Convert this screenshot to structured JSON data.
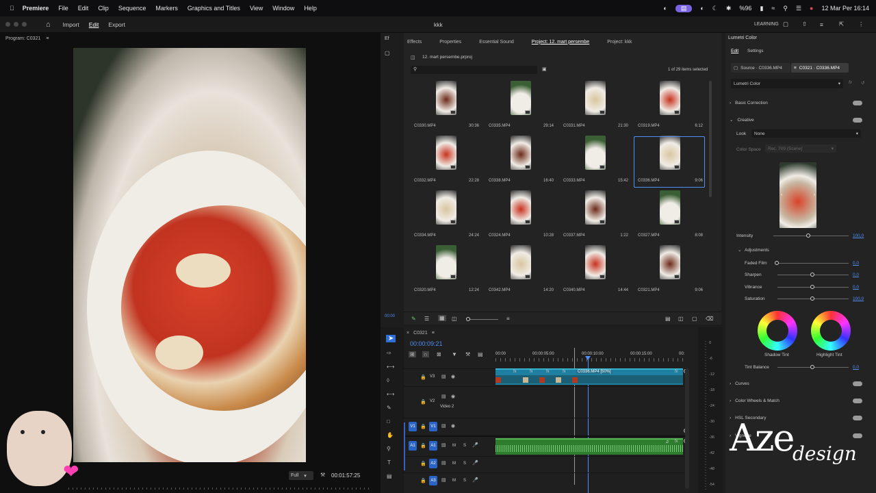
{
  "menubar": {
    "app": "Premiere",
    "items": [
      "File",
      "Edit",
      "Clip",
      "Sequence",
      "Markers",
      "Graphics and Titles",
      "View",
      "Window",
      "Help"
    ],
    "battery": "%96",
    "datetime": "12 Mar Per  16:14"
  },
  "appbar": {
    "tabs": [
      "Import",
      "Edit",
      "Export"
    ],
    "project_title": "kkk",
    "workspace": "LEARNING"
  },
  "program": {
    "title": "Program: C0321",
    "fit": "Full",
    "timecode": "00:01:57:25"
  },
  "project_panel": {
    "tabs": [
      "Effects",
      "Properties",
      "Essential Sound",
      "Project: 12. mart persembe",
      "Project: kkk"
    ],
    "side_label": "Ef",
    "path": "12. mart persembe.prproj",
    "count": "1 of 29 items selected",
    "clips": [
      {
        "name": "C0330.MP4",
        "dur": "30:36"
      },
      {
        "name": "C0335.MP4",
        "dur": "29:14"
      },
      {
        "name": "C0331.MP4",
        "dur": "21:30"
      },
      {
        "name": "C0319.MP4",
        "dur": "6:12"
      },
      {
        "name": "C0332.MP4",
        "dur": "22:28"
      },
      {
        "name": "C0338.MP4",
        "dur": "16:40"
      },
      {
        "name": "C0333.MP4",
        "dur": "15:42"
      },
      {
        "name": "C0336.MP4",
        "dur": "9:06"
      },
      {
        "name": "C0334.MP4",
        "dur": "24:24"
      },
      {
        "name": "C0324.MP4",
        "dur": "10:28"
      },
      {
        "name": "C0337.MP4",
        "dur": "1:22"
      },
      {
        "name": "C0327.MP4",
        "dur": "8:08"
      },
      {
        "name": "C0320.MP4",
        "dur": "12:24"
      },
      {
        "name": "C0342.MP4",
        "dur": "14:20"
      },
      {
        "name": "C0340.MP4",
        "dur": "14:44"
      },
      {
        "name": "C0321.MP4",
        "dur": "9:06"
      }
    ]
  },
  "timeline": {
    "sequence": "C0321",
    "timecode": "00:00:09:21",
    "ruler": [
      "00:00",
      "00:00:05:00",
      "00:00:10:00",
      "00:00:15:00",
      "00:"
    ],
    "clip_label": "C0336.MP4 [50%]",
    "tracks": {
      "v3": "V3",
      "v2": "V2",
      "v2_name": "Video 2",
      "v1": "V1",
      "a1": "A1",
      "a2": "A2",
      "a3": "A3",
      "m": "M",
      "s": "S"
    },
    "meter_ticks": [
      "0",
      "-6",
      "-12",
      "-18",
      "-24",
      "-30",
      "-36",
      "-42",
      "-48",
      "-54"
    ],
    "side_timecode": "00:00"
  },
  "lumetri": {
    "title": "Lumetri Color",
    "tabs": [
      "Edit",
      "Settings"
    ],
    "source": "Source · C0336.MP4",
    "target": "C0321 · C0336.MP4",
    "effect": "Lumetri Color",
    "sections": {
      "basic": "Basic Correction",
      "creative": "Creative",
      "curves": "Curves",
      "wheels": "Color Wheels & Match",
      "secondary": "HSL Secondary",
      "vignette": "Vignette"
    },
    "look_label": "Look",
    "look_value": "None",
    "colorspace_label": "Color Space",
    "colorspace_value": "Rec. 709 (Scene)",
    "intensity_label": "Intensity",
    "intensity_value": "100,0",
    "adjustments": "Adjustments",
    "faded_label": "Faded Film",
    "faded_value": "0,0",
    "sharpen_label": "Sharpen",
    "sharpen_value": "0,0",
    "vibrance_label": "Vibrance",
    "vibrance_value": "0,0",
    "saturation_label": "Saturation",
    "saturation_value": "100,0",
    "shadow_tint": "Shadow Tint",
    "highlight_tint": "Highlight Tint",
    "tint_label": "Tint Balance",
    "tint_value": "0,0"
  },
  "watermark": {
    "text": "Aze design"
  }
}
